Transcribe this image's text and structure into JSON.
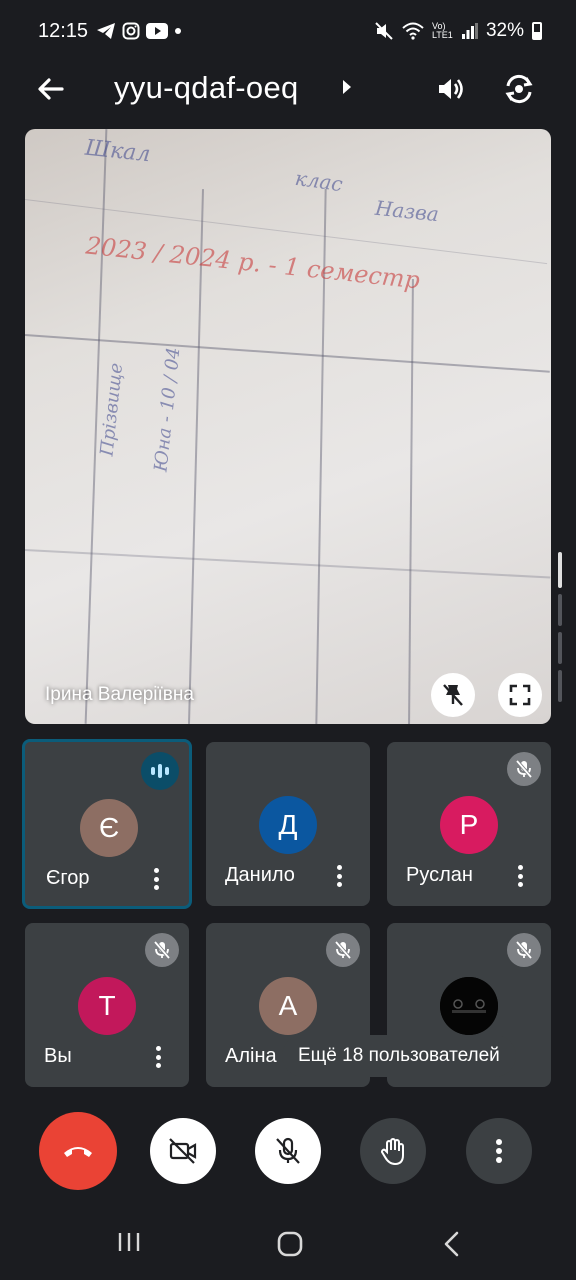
{
  "status_bar": {
    "time": "12:15",
    "network_label": "Vo) LTE1",
    "battery": "32%"
  },
  "header": {
    "meeting_code": "yyu-qdaf-oeq"
  },
  "main_video": {
    "speaker_name": "Ірина Валеріївна"
  },
  "participants": [
    {
      "name": "Єгор",
      "initial": "Є",
      "avatar_color": "#8d6e63",
      "mic": "speaking"
    },
    {
      "name": "Данило",
      "initial": "Д",
      "avatar_color": "#0b57a0",
      "mic": "on"
    },
    {
      "name": "Руслан",
      "initial": "Р",
      "avatar_color": "#d81b60",
      "mic": "muted"
    },
    {
      "name": "Вы",
      "initial": "Т",
      "avatar_color": "#c2185b",
      "mic": "muted"
    },
    {
      "name": "Аліна",
      "initial": "А",
      "avatar_color": "#8d6e63",
      "mic": "muted"
    },
    {
      "name": "",
      "initial": "",
      "avatar_color": "#000000",
      "mic": "muted"
    }
  ],
  "more_users_label": "Ещё 18 пользователей",
  "controls": {
    "end_call_color": "#ea4335",
    "icons": [
      "end-call-icon",
      "camera-off-icon",
      "mic-off-icon",
      "raise-hand-icon",
      "more-options-icon"
    ]
  },
  "accent_color": "#0b5c7a"
}
